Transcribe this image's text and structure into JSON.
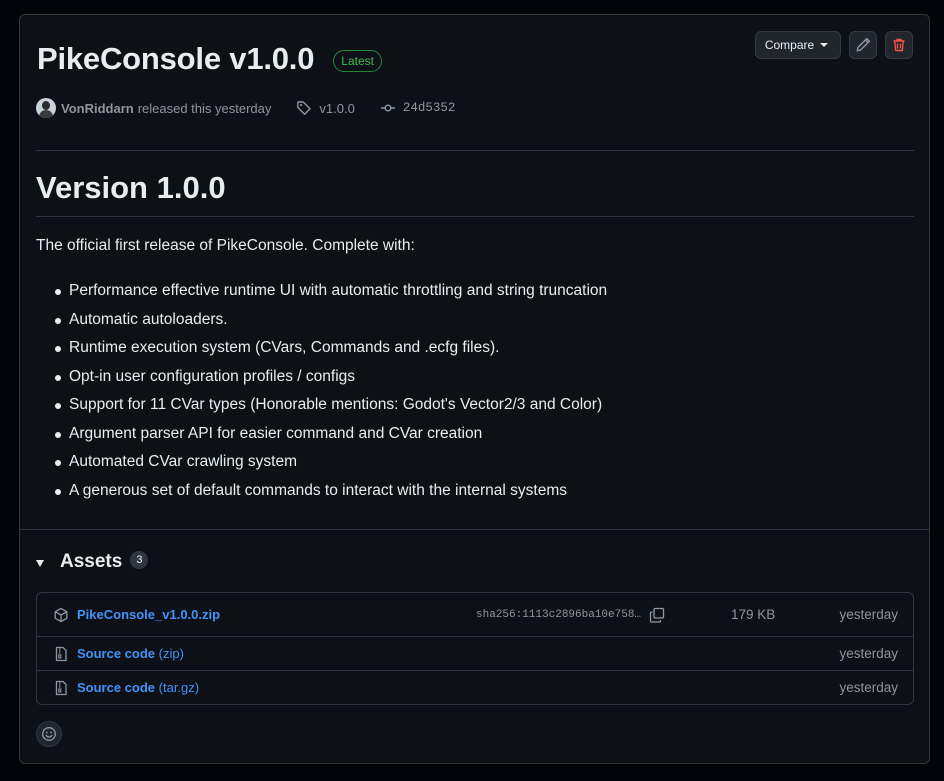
{
  "release": {
    "title": "PikeConsole v1.0.0",
    "latest_badge": "Latest",
    "author": "VonRiddarn",
    "released_text": "released this yesterday",
    "tag": "v1.0.0",
    "commit": "24d5352"
  },
  "actions": {
    "compare_label": "Compare",
    "edit_icon": "pencil-icon",
    "delete_icon": "trash-icon"
  },
  "body": {
    "heading": "Version 1.0.0",
    "intro": "The official first release of PikeConsole. Complete with:",
    "features": [
      "Performance effective runtime UI with automatic throttling and string truncation",
      "Automatic autoloaders.",
      "Runtime execution system (CVars, Commands and .ecfg files).",
      "Opt-in user configuration profiles / configs",
      "Support for 11 CVar types (Honorable mentions: Godot's Vector2/3 and Color)",
      "Argument parser API for easier command and CVar creation",
      "Automated CVar crawling system",
      "A generous set of default commands to interact with the internal systems"
    ]
  },
  "assets": {
    "title": "Assets",
    "count": "3",
    "items": [
      {
        "name": "PikeConsole_v1.0.0.zip",
        "suffix": "",
        "sha": "sha256:1113c2896ba10e758…",
        "size": "179 KB",
        "date": "yesterday",
        "icon": "package-icon"
      },
      {
        "name": "Source code",
        "suffix": " (zip)",
        "sha": "",
        "size": "",
        "date": "yesterday",
        "icon": "file-zip-icon"
      },
      {
        "name": "Source code",
        "suffix": " (tar.gz)",
        "sha": "",
        "size": "",
        "date": "yesterday",
        "icon": "file-zip-icon"
      }
    ]
  },
  "colors": {
    "background": "#0d1117",
    "link": "#4493f8",
    "latest": "#3fb950",
    "danger": "#f85149",
    "muted": "#8d96a0"
  }
}
